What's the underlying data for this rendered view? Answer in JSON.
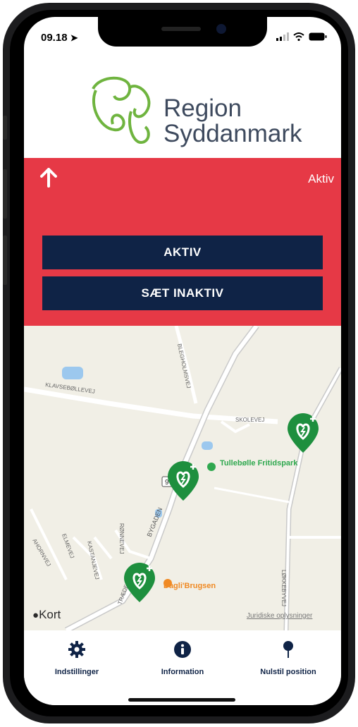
{
  "status_bar": {
    "time": "09.18"
  },
  "header": {
    "logo_line1": "Region",
    "logo_line2": "Syddanmark"
  },
  "alert": {
    "status": "Aktiv",
    "color": "#e63946"
  },
  "buttons": {
    "active": "AKTIV",
    "deactivate": "SÆT INAKTIV"
  },
  "map": {
    "roads": [
      "KLAVSEBØLLEVEJ",
      "BLEGHOLMSVEJ",
      "SKOLEVEJ",
      "BYGADEN",
      "ELMEVEJ",
      "KASTANJEVEJ",
      "AHORNVEJ",
      "RØNNEVEJ",
      "LØKKEBYVEJ",
      "TRÆDE"
    ],
    "pois": [
      "Tullebølle Fritidspark",
      "Dagli'Brugsen"
    ],
    "brand": "Kort",
    "legal": "Juridiske oplysninger",
    "marker_color": "#1e8f3e"
  },
  "tab_bar": {
    "items": [
      {
        "label": "Indstillinger",
        "icon": "gear-icon"
      },
      {
        "label": "Information",
        "icon": "info-icon"
      },
      {
        "label": "Nulstil position",
        "icon": "pin-icon"
      }
    ]
  }
}
